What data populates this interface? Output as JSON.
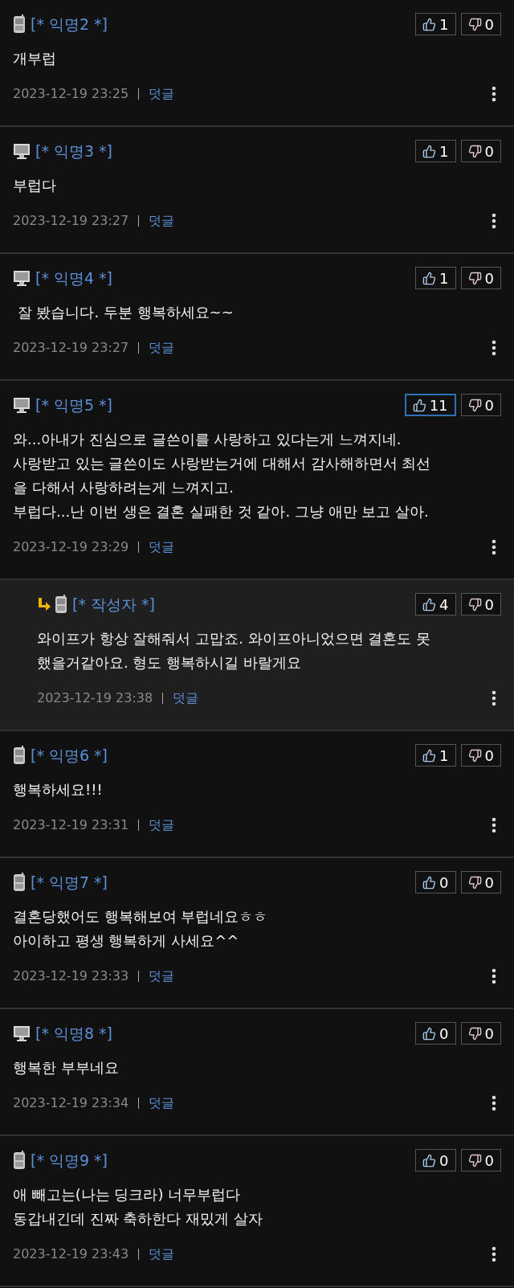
{
  "comments": [
    {
      "kind": "mobile",
      "author": "[* 익명2 *]",
      "text": "개부럽",
      "date": "2023-12-19 23:25",
      "reply_label": "덧글",
      "likes": {
        "count": "1",
        "selected": false
      },
      "dislikes": {
        "count": "0",
        "selected": false
      }
    },
    {
      "kind": "pc",
      "author": "[* 익명3 *]",
      "text": "부럽다",
      "date": "2023-12-19 23:27",
      "reply_label": "덧글",
      "likes": {
        "count": "1",
        "selected": false
      },
      "dislikes": {
        "count": "0",
        "selected": false
      }
    },
    {
      "kind": "pc",
      "author": "[* 익명4 *]",
      "text": " 잘 봤습니다. 두분 행복하세요~~",
      "date": "2023-12-19 23:27",
      "reply_label": "덧글",
      "likes": {
        "count": "1",
        "selected": false
      },
      "dislikes": {
        "count": "0",
        "selected": false
      }
    },
    {
      "kind": "pc",
      "author": "[* 익명5 *]",
      "text": "와...아내가 진심으로 글쓴이를 사랑하고 있다는게 느껴지네.\n사랑받고 있는 글쓴이도 사랑받는거에 대해서 감사해하면서 최선\n을 다해서 사랑하려는게 느껴지고.\n부럽다...난 이번 생은 결혼 실패한 것 같아. 그냥 애만 보고 살아.",
      "date": "2023-12-19 23:29",
      "reply_label": "덧글",
      "likes": {
        "count": "11",
        "selected": true
      },
      "dislikes": {
        "count": "0",
        "selected": false
      },
      "children": [
        {
          "kind": "mobile",
          "author": "[* 작성자 *]",
          "text": "와이프가 항상 잘해줘서 고맙죠. 와이프아니었으면 결혼도 못\n했을거같아요. 형도 행복하시길 바랄게요",
          "date": "2023-12-19 23:38",
          "reply_label": "덧글",
          "likes": {
            "count": "4",
            "selected": false
          },
          "dislikes": {
            "count": "0",
            "selected": false
          }
        }
      ]
    },
    {
      "kind": "mobile",
      "author": "[* 익명6 *]",
      "text": "행복하세요!!!",
      "date": "2023-12-19 23:31",
      "reply_label": "덧글",
      "likes": {
        "count": "1",
        "selected": false
      },
      "dislikes": {
        "count": "0",
        "selected": false
      }
    },
    {
      "kind": "mobile",
      "author": "[* 익명7 *]",
      "text": "결혼당했어도 행복해보여 부럽네요ㅎㅎ\n아이하고 평생 행복하게 사세요^^",
      "date": "2023-12-19 23:33",
      "reply_label": "덧글",
      "likes": {
        "count": "0",
        "selected": false
      },
      "dislikes": {
        "count": "0",
        "selected": false
      }
    },
    {
      "kind": "pc",
      "author": "[* 익명8 *]",
      "text": "행복한 부부네요",
      "date": "2023-12-19 23:34",
      "reply_label": "덧글",
      "likes": {
        "count": "0",
        "selected": false
      },
      "dislikes": {
        "count": "0",
        "selected": false
      }
    },
    {
      "kind": "mobile",
      "author": "[* 익명9 *]",
      "text": "애 빼고는(나는 딩크라) 너무부럽다\n동갑내긴데 진짜 축하한다 재밌게 살자",
      "date": "2023-12-19 23:43",
      "reply_label": "덧글",
      "likes": {
        "count": "0",
        "selected": false
      },
      "dislikes": {
        "count": "0",
        "selected": false
      }
    }
  ]
}
